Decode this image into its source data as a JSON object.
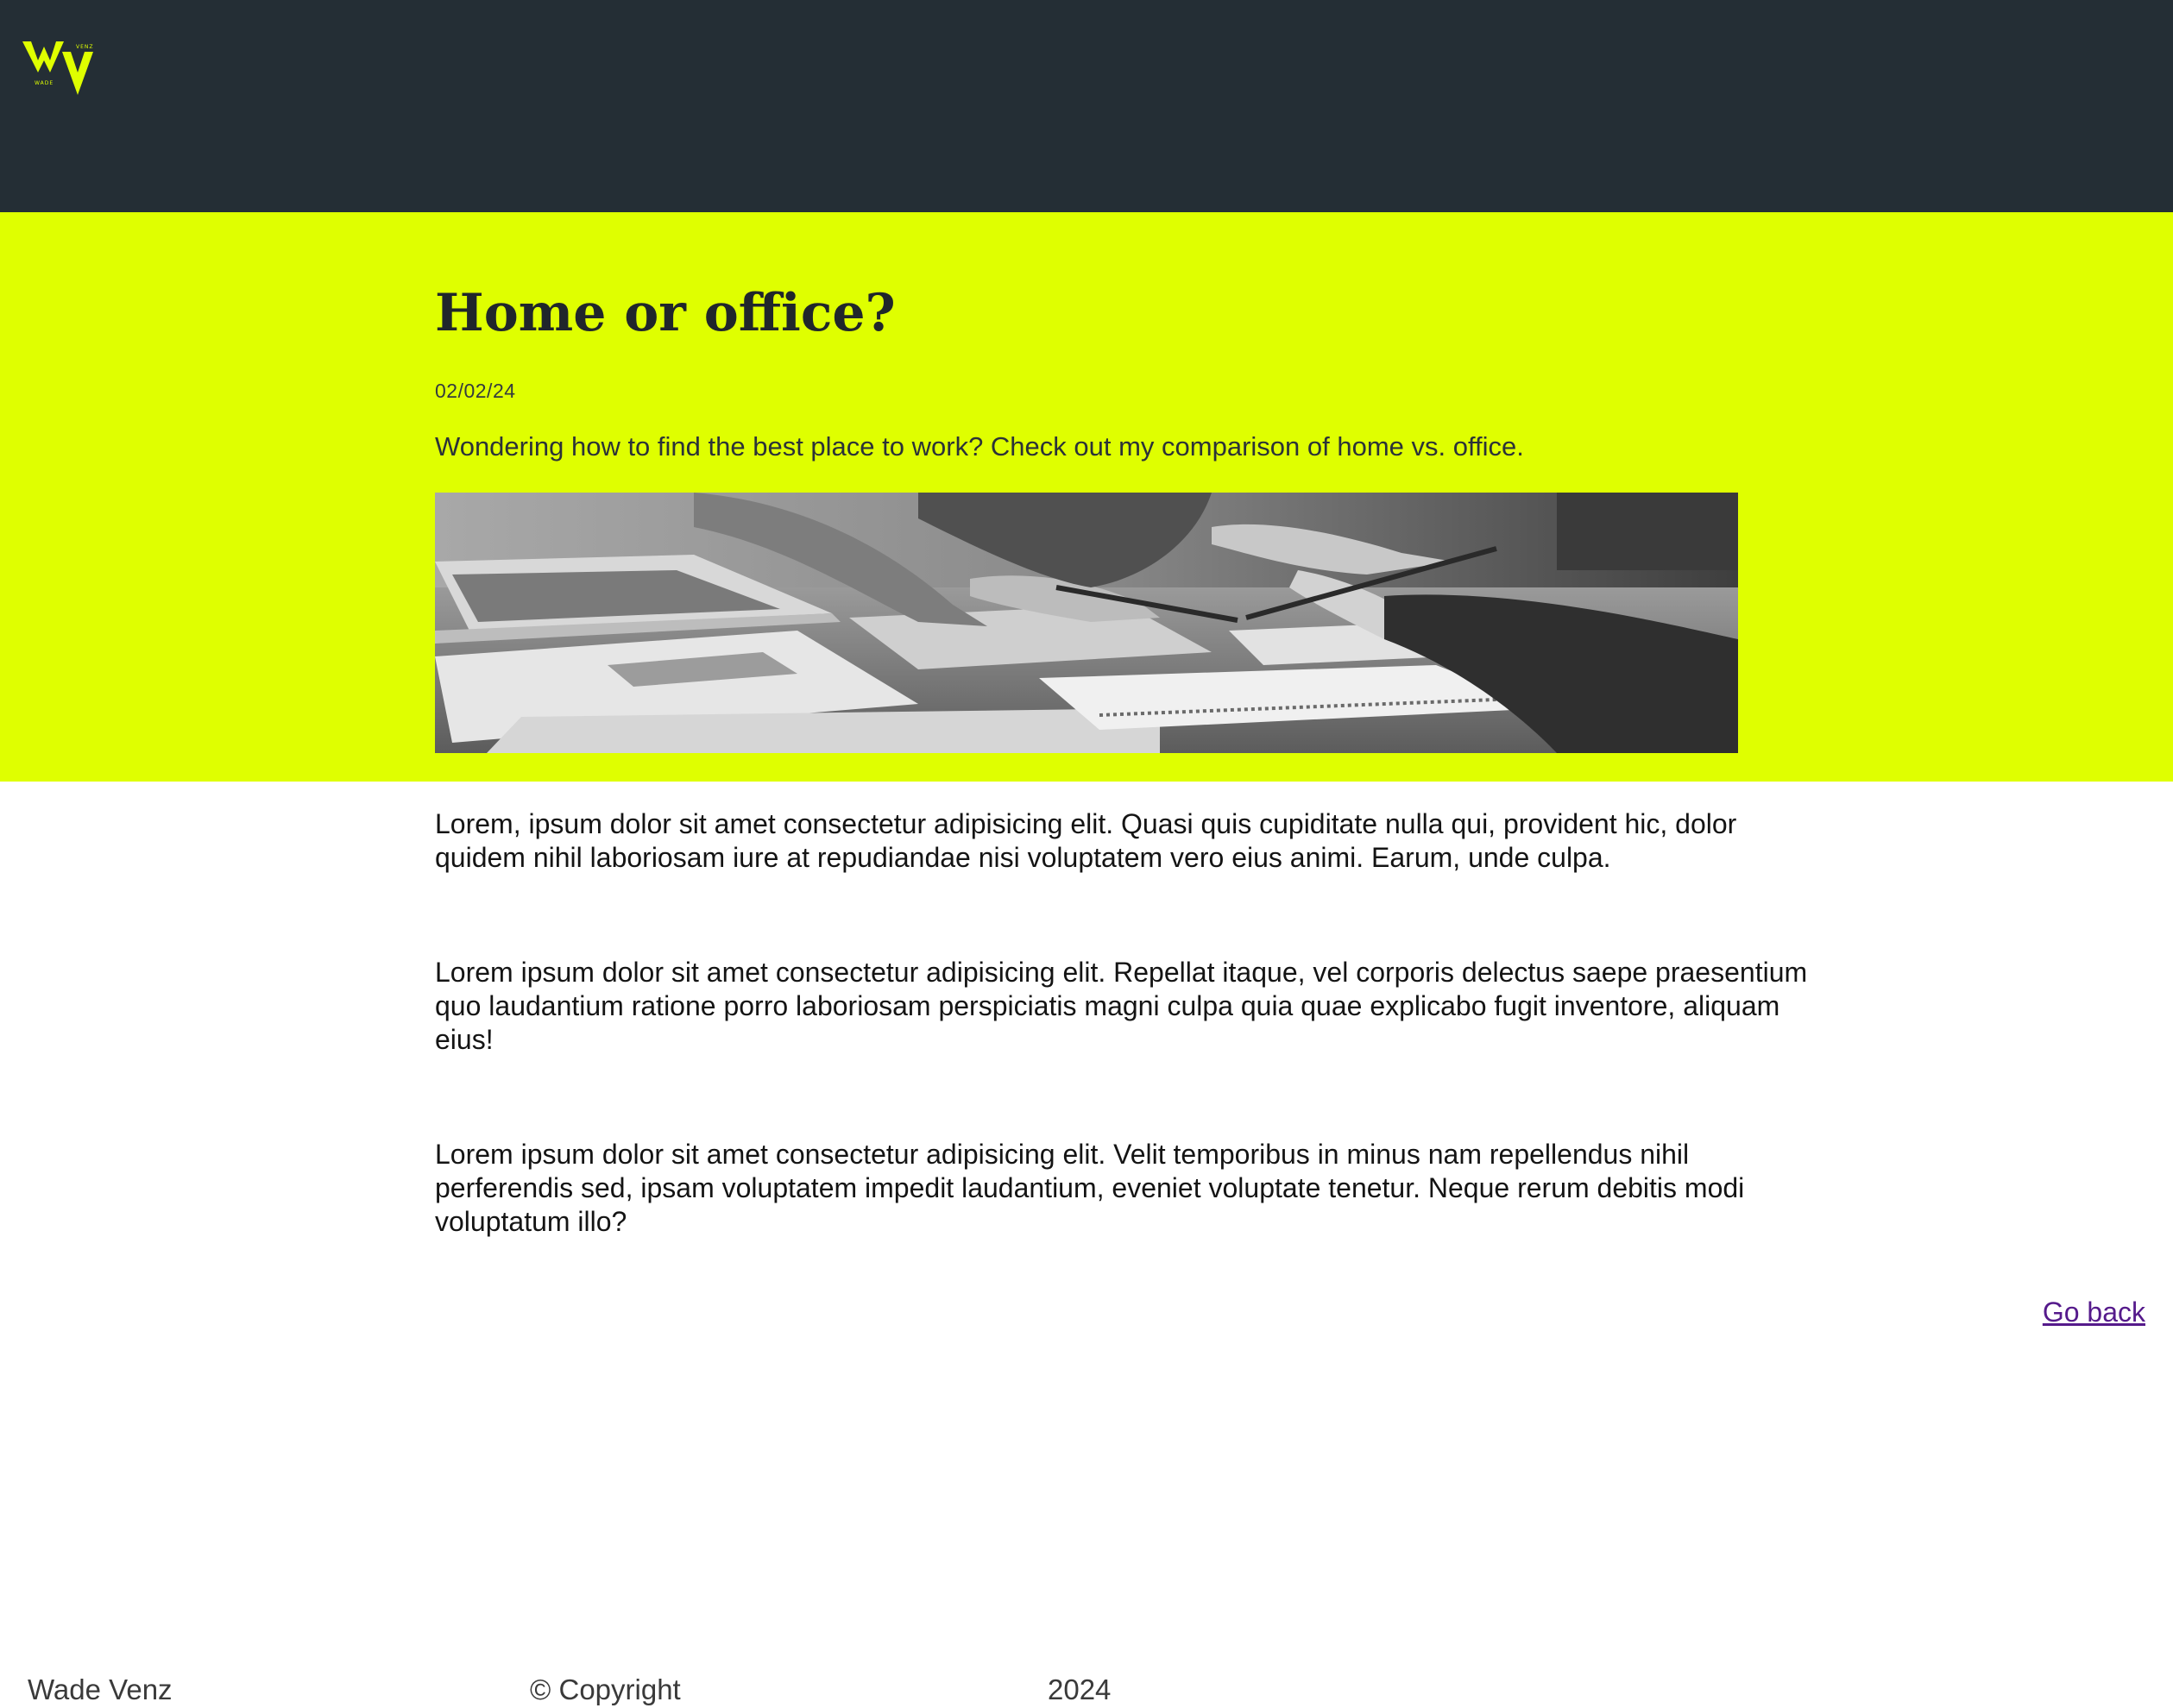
{
  "header": {
    "logo": {
      "mark": "WV",
      "top_text": "VENZ",
      "bottom_text": "WADE",
      "color": "#dfff00"
    },
    "background": "#242e35"
  },
  "post": {
    "title": "Home or office?",
    "date": "02/02/24",
    "lead": "Wondering how to find the best place to work? Check out my comparison of home vs. office.",
    "hero_image": "grayscale photo of people working at a desk with a laptop, papers and pens",
    "band_color": "#dfff00",
    "paragraphs": [
      "Lorem, ipsum dolor sit amet consectetur adipisicing elit. Quasi quis cupiditate nulla qui, provident hic, dolor quidem nihil laboriosam iure at repudiandae nisi voluptatem vero eius animi. Earum, unde culpa.",
      "Lorem ipsum dolor sit amet consectetur adipisicing elit. Repellat itaque, vel corporis delectus saepe praesentium quo laudantium ratione porro laboriosam perspiciatis magni culpa quia quae explicabo fugit inventore, aliquam eius!",
      "Lorem ipsum dolor sit amet consectetur adipisicing elit. Velit temporibus in minus nam repellendus nihil perferendis sed, ipsam voluptatem impedit laudantium, eveniet voluptate tenetur. Neque rerum debitis modi voluptatum illo?"
    ]
  },
  "navigation": {
    "go_back_label": "Go back"
  },
  "footer": {
    "name": "Wade Venz",
    "copyright": "© Copyright",
    "year": "2024"
  }
}
